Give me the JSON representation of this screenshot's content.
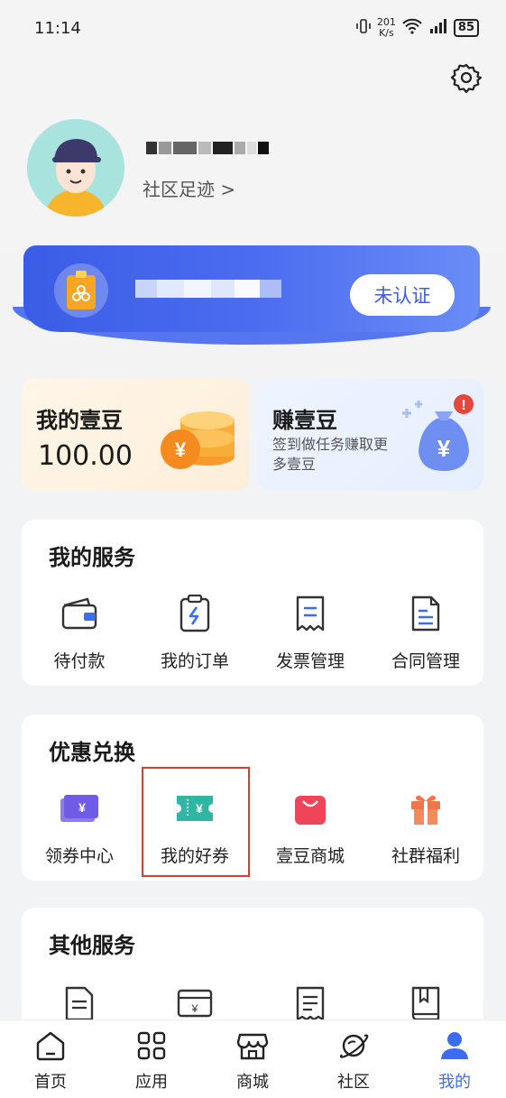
{
  "status_bar": {
    "time": "11:14",
    "net_speed_top": "201",
    "net_speed_bottom": "K/s",
    "battery": "85"
  },
  "profile": {
    "footprint_link": "社区足迹 >"
  },
  "banner": {
    "verify_label": "未认证"
  },
  "beans": {
    "title": "我的壹豆",
    "value": "100.00"
  },
  "earn": {
    "title": "赚壹豆",
    "desc": "签到做任务赚取更多壹豆"
  },
  "services": {
    "title": "我的服务",
    "items": [
      {
        "label": "待付款",
        "icon": "wallet-icon"
      },
      {
        "label": "我的订单",
        "icon": "order-clipboard-icon"
      },
      {
        "label": "发票管理",
        "icon": "invoice-icon"
      },
      {
        "label": "合同管理",
        "icon": "contract-icon"
      }
    ]
  },
  "discounts": {
    "title": "优惠兑换",
    "items": [
      {
        "label": "领券中心",
        "icon": "coupon-center-icon"
      },
      {
        "label": "我的好券",
        "icon": "my-coupon-icon"
      },
      {
        "label": "壹豆商城",
        "icon": "shopping-bag-icon"
      },
      {
        "label": "社群福利",
        "icon": "gift-icon"
      }
    ]
  },
  "other": {
    "title": "其他服务"
  },
  "tabbar": {
    "items": [
      {
        "label": "首页",
        "icon": "home-icon"
      },
      {
        "label": "应用",
        "icon": "apps-grid-icon"
      },
      {
        "label": "商城",
        "icon": "store-icon"
      },
      {
        "label": "社区",
        "icon": "planet-icon"
      },
      {
        "label": "我的",
        "icon": "profile-icon"
      }
    ]
  },
  "colors": {
    "accent": "#3b6df0",
    "banner": "#4b6cf0",
    "highlight_border": "#e33a2e"
  }
}
